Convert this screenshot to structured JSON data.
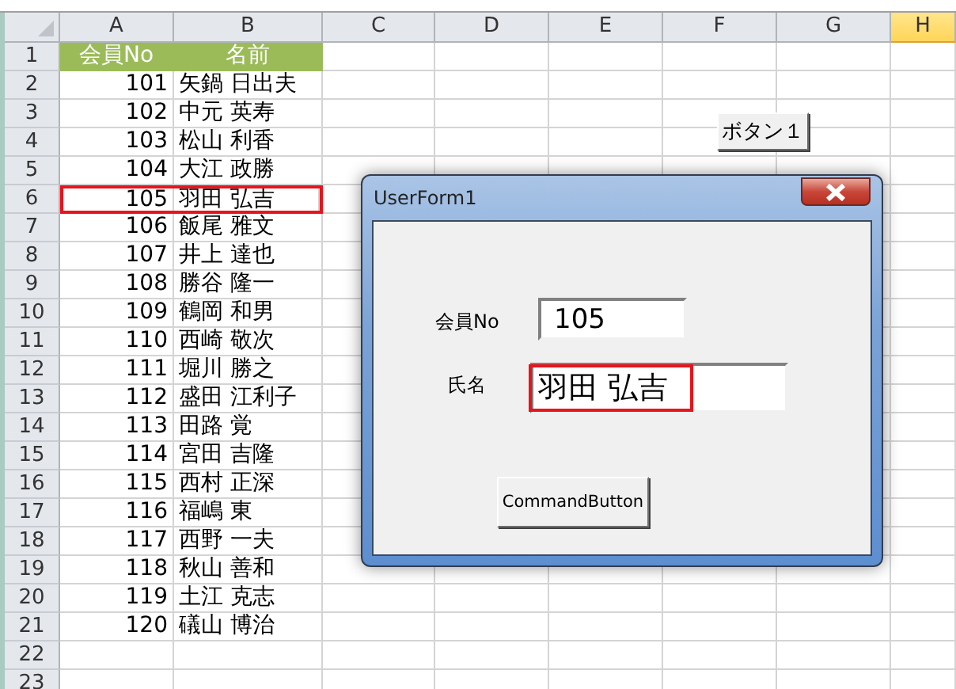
{
  "sheet": {
    "columns": [
      {
        "label": "A",
        "selected": false
      },
      {
        "label": "B",
        "selected": false
      },
      {
        "label": "C",
        "selected": false
      },
      {
        "label": "D",
        "selected": false
      },
      {
        "label": "E",
        "selected": false
      },
      {
        "label": "F",
        "selected": false
      },
      {
        "label": "G",
        "selected": false
      },
      {
        "label": "H",
        "selected": true
      }
    ],
    "rows": [
      {
        "label": "1",
        "kind": "header",
        "highlighted": false,
        "cells": [
          "会員No",
          "名前"
        ]
      },
      {
        "label": "2",
        "kind": "data",
        "highlighted": false,
        "cells": [
          "101",
          "矢鍋 日出夫"
        ]
      },
      {
        "label": "3",
        "kind": "data",
        "highlighted": false,
        "cells": [
          "102",
          "中元 英寿"
        ]
      },
      {
        "label": "4",
        "kind": "data",
        "highlighted": false,
        "cells": [
          "103",
          "松山 利香"
        ]
      },
      {
        "label": "5",
        "kind": "data",
        "highlighted": false,
        "cells": [
          "104",
          "大江 政勝"
        ]
      },
      {
        "label": "6",
        "kind": "data",
        "highlighted": true,
        "cells": [
          "105",
          "羽田 弘吉"
        ]
      },
      {
        "label": "7",
        "kind": "data",
        "highlighted": false,
        "cells": [
          "106",
          "飯尾 雅文"
        ]
      },
      {
        "label": "8",
        "kind": "data",
        "highlighted": false,
        "cells": [
          "107",
          "井上 達也"
        ]
      },
      {
        "label": "9",
        "kind": "data",
        "highlighted": false,
        "cells": [
          "108",
          "勝谷 隆一"
        ]
      },
      {
        "label": "10",
        "kind": "data",
        "highlighted": false,
        "cells": [
          "109",
          "鶴岡 和男"
        ]
      },
      {
        "label": "11",
        "kind": "data",
        "highlighted": false,
        "cells": [
          "110",
          "西崎 敬次"
        ]
      },
      {
        "label": "12",
        "kind": "data",
        "highlighted": false,
        "cells": [
          "111",
          "堀川 勝之"
        ]
      },
      {
        "label": "13",
        "kind": "data",
        "highlighted": false,
        "cells": [
          "112",
          "盛田 江利子"
        ]
      },
      {
        "label": "14",
        "kind": "data",
        "highlighted": false,
        "cells": [
          "113",
          "田路 覚"
        ]
      },
      {
        "label": "15",
        "kind": "data",
        "highlighted": false,
        "cells": [
          "114",
          "宮田 吉隆"
        ]
      },
      {
        "label": "16",
        "kind": "data",
        "highlighted": false,
        "cells": [
          "115",
          "西村 正深"
        ]
      },
      {
        "label": "17",
        "kind": "data",
        "highlighted": false,
        "cells": [
          "116",
          "福嶋 東"
        ]
      },
      {
        "label": "18",
        "kind": "data",
        "highlighted": false,
        "cells": [
          "117",
          "西野 一夫"
        ]
      },
      {
        "label": "19",
        "kind": "data",
        "highlighted": false,
        "cells": [
          "118",
          "秋山 善和"
        ]
      },
      {
        "label": "20",
        "kind": "data",
        "highlighted": false,
        "cells": [
          "119",
          "土江 克志"
        ]
      },
      {
        "label": "21",
        "kind": "data",
        "highlighted": false,
        "cells": [
          "120",
          "礒山 博治"
        ]
      },
      {
        "label": "22",
        "kind": "data",
        "highlighted": false
      },
      {
        "label": "23",
        "kind": "data",
        "highlighted": false
      }
    ],
    "form_button": "ボタン１"
  },
  "dialog": {
    "title": "UserForm1",
    "fields": [
      {
        "label": "会員No",
        "value": "105",
        "highlighted": false
      },
      {
        "label": "氏名",
        "value": "羽田 弘吉",
        "highlighted": true
      }
    ],
    "button": "CommandButton"
  }
}
